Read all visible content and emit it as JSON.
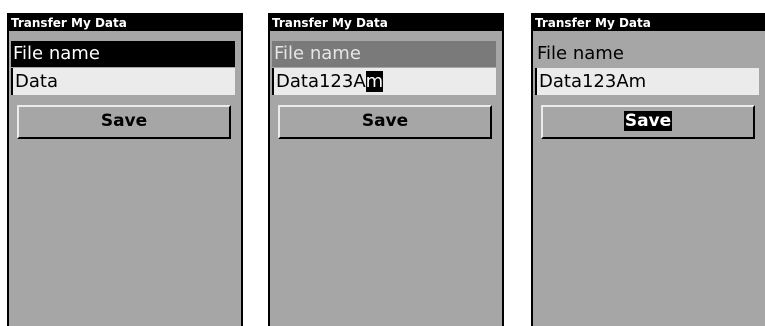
{
  "screens": [
    {
      "title": "Transfer My Data",
      "field_label": "File name",
      "field_value": "Data",
      "cursor_char": "",
      "save_label": "Save"
    },
    {
      "title": "Transfer My Data",
      "field_label": "File name",
      "field_value": "Data123A",
      "cursor_char": "m",
      "save_label": "Save"
    },
    {
      "title": "Transfer My Data",
      "field_label": "File name",
      "field_value": "Data123Am",
      "cursor_char": "",
      "save_label": "Save"
    }
  ]
}
